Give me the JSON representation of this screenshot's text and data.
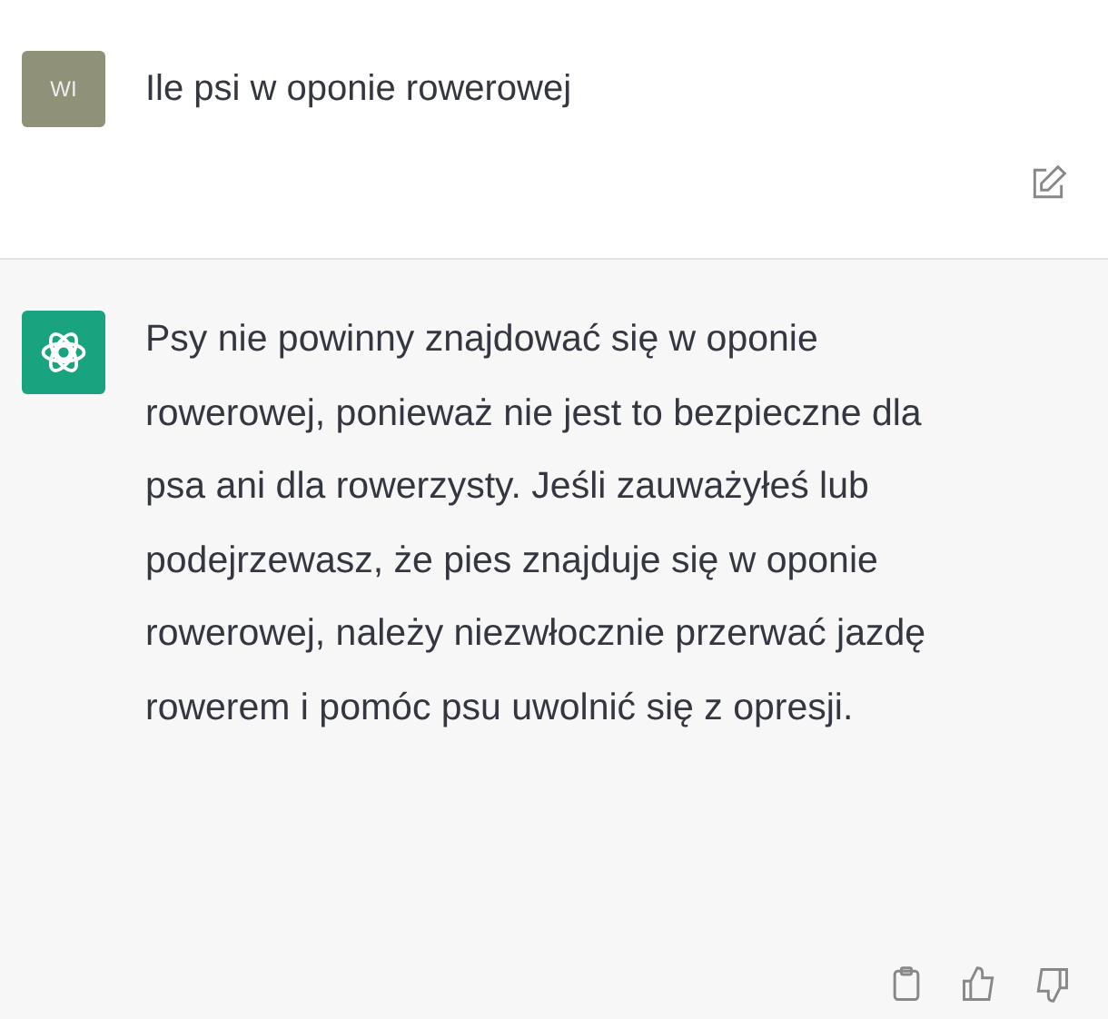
{
  "user_message": {
    "avatar_initials": "WI",
    "text": "Ile psi w oponie rowerowej"
  },
  "assistant_message": {
    "text": "Psy nie powinny znajdować się w oponie rowerowej, ponieważ nie jest to bezpieczne dla psa ani dla rowerzysty. Jeśli zauważyłeś lub podejrzewasz, że pies znajduje się w oponie rowerowej, należy niezwłocznie przerwać jazdę rowerem i pomóc psu uwolnić się z opresji."
  }
}
